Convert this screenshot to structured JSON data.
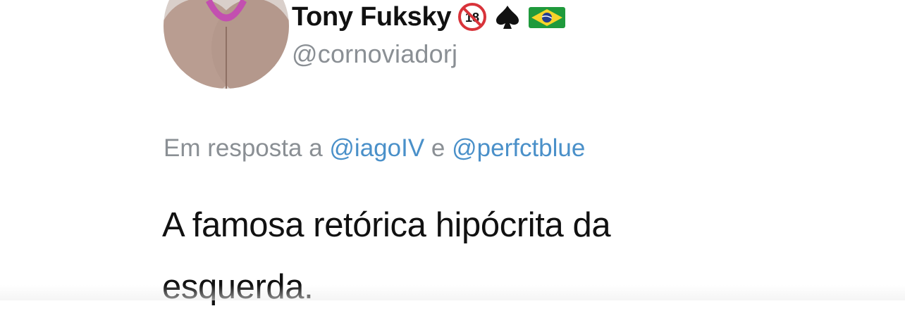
{
  "tweet": {
    "display_name": "Tony Fuksky",
    "badges": {
      "no_under_18": "18",
      "spade": "♠",
      "flag": "brazil-flag"
    },
    "handle": "@cornoviadorj",
    "reply": {
      "prefix": "Em resposta a",
      "mention_1": "@iagoIV",
      "joiner": "e",
      "mention_2": "@perfctblue"
    },
    "text_line_1": "A famosa retórica hipócrita da",
    "text_line_2": "esquerda."
  },
  "colors": {
    "name": "#111111",
    "handle": "#8a8f94",
    "mention": "#4a90c9"
  }
}
